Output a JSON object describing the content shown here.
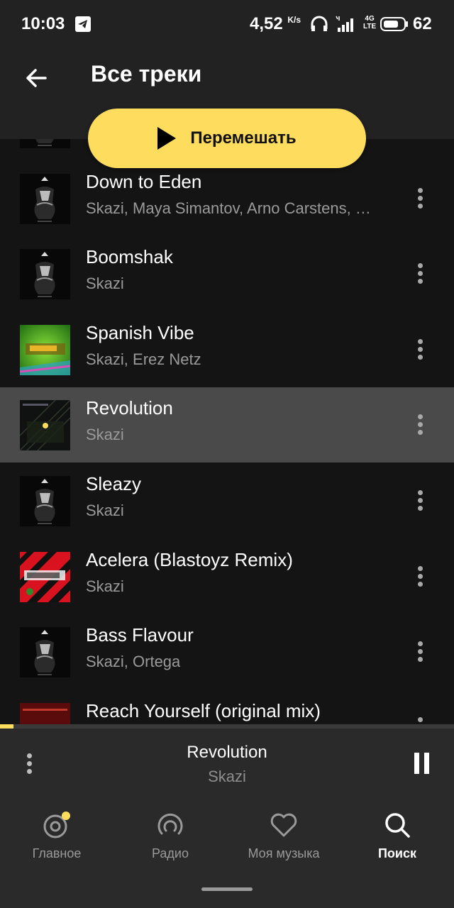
{
  "status_bar": {
    "time": "10:03",
    "speed": "4,52",
    "speed_unit": "K/s",
    "network": "4G",
    "network_sub": "LTE",
    "battery": "62"
  },
  "header": {
    "title": "Все треки"
  },
  "shuffle": {
    "label": "Перемешать"
  },
  "tracks": [
    {
      "title": "Down to Eden",
      "artist": "Skazi, Maya Simantov, Arno Carstens, …",
      "cover": "skazi"
    },
    {
      "title": "Boomshak",
      "artist": "Skazi",
      "cover": "skazi"
    },
    {
      "title": "Spanish Vibe",
      "artist": "Skazi, Erez Netz",
      "cover": "goa"
    },
    {
      "title": "Revolution",
      "artist": "Skazi",
      "cover": "revolution",
      "active": true
    },
    {
      "title": "Sleazy",
      "artist": "Skazi",
      "cover": "skazi"
    },
    {
      "title": "Acelera (Blastoyz Remix)",
      "artist": "Skazi",
      "cover": "acelera"
    },
    {
      "title": "Bass Flavour",
      "artist": "Skazi, Ortega",
      "cover": "skazi"
    },
    {
      "title": "Reach Yourself (original mix)",
      "artist": "",
      "cover": "reach"
    }
  ],
  "now_playing": {
    "title": "Revolution",
    "artist": "Skazi",
    "progress": 0.03
  },
  "nav": [
    {
      "label": "Главное",
      "icon": "home-disc-icon"
    },
    {
      "label": "Радио",
      "icon": "radio-icon"
    },
    {
      "label": "Моя музыка",
      "icon": "heart-icon"
    },
    {
      "label": "Поиск",
      "icon": "search-icon",
      "active": true
    }
  ],
  "colors": {
    "accent": "#fedc5e",
    "background": "#141414",
    "header": "#222222",
    "active_row": "#4a4a4a"
  }
}
